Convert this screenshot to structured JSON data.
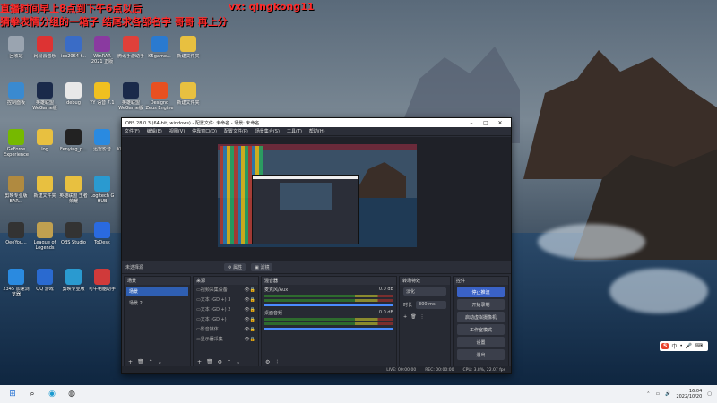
{
  "overlay": {
    "line1": "直播时间早上8点到下午6点以后",
    "line2": "猜拳表情分组的一箱子 结尾求各部名字 哥哥 再上分",
    "wx": "vx: qingkong11"
  },
  "desktop_icons": [
    {
      "label": "回收站",
      "color": "#9aa4b0"
    },
    {
      "label": "网易云音乐",
      "color": "#d33"
    },
    {
      "label": "ico2064-f...",
      "color": "#3a6cc6"
    },
    {
      "label": "WinRAR 2021 正版",
      "color": "#8a3aa0"
    },
    {
      "label": "腾讯手游助手",
      "color": "#e0403a"
    },
    {
      "label": "K5game...",
      "color": "#2a7ad0"
    },
    {
      "label": "新建文件夹",
      "color": "#e8c040"
    },
    {
      "label": "控制面板",
      "color": "#3a8ad0"
    },
    {
      "label": "英雄联盟 WeGame版",
      "color": "#1a2a4a"
    },
    {
      "label": "debug",
      "color": "#e8e8e8"
    },
    {
      "label": "YY 语音 7.1",
      "color": "#f0c020"
    },
    {
      "label": "英雄联盟 WeGame版",
      "color": "#1a2a4a"
    },
    {
      "label": "Designd Zeus Engine",
      "color": "#e85020"
    },
    {
      "label": "新建文件夹",
      "color": "#e8c040"
    },
    {
      "label": "GeForce Experience",
      "color": "#76b900"
    },
    {
      "label": "log",
      "color": "#e8c040"
    },
    {
      "label": "Fenying_p...",
      "color": "#222"
    },
    {
      "label": "迅雷影音",
      "color": "#2a8ae0"
    },
    {
      "label": "KLY-LOL 助手",
      "color": "#2a6ad0"
    },
    {
      "label": "Narakа",
      "color": "#e8c040"
    },
    {
      "label": "Idiot 4.0",
      "color": "#f0c020"
    },
    {
      "label": "剪映专业版 BAR...",
      "color": "#b08a40"
    },
    {
      "label": "新建文件夹",
      "color": "#e8c040"
    },
    {
      "label": "英雄联盟 王者荣耀",
      "color": "#e8c040"
    },
    {
      "label": "Logitech G HUB",
      "color": "#2a9ad0"
    },
    {
      "label": "剪映",
      "color": "#222"
    },
    {
      "label": "QQ 游戏",
      "color": "#2a6ad0"
    },
    {
      "label": "Microsoft Edge",
      "color": "#1a9ad0"
    },
    {
      "label": "QeeYou...",
      "color": "#333"
    },
    {
      "label": "League of Legends",
      "color": "#c0a050"
    },
    {
      "label": "OBS Studio",
      "color": "#333"
    },
    {
      "label": "ToDesk",
      "color": "#2a6ae0"
    },
    {
      "label": "QQ 游戏",
      "color": "#2a6ad0"
    },
    {
      "label": "雷电模拟器",
      "color": "#f0c020"
    },
    {
      "label": "腾讯QQ",
      "color": "#2a8ae0"
    },
    {
      "label": "2345 加速浏览器",
      "color": "#2a8ae0"
    },
    {
      "label": "QQ 游戏",
      "color": "#2a6ad0"
    },
    {
      "label": "剪映专业版",
      "color": "#2a9ad0"
    },
    {
      "label": "可牛电脑助手",
      "color": "#d03a3a"
    },
    {
      "label": "Adobe Premie...",
      "color": "#2a1a4a"
    },
    {
      "label": "RiotClient 快捷方式",
      "color": "#d03a3a"
    },
    {
      "label": "英雄联盟",
      "color": "#1a2a4a"
    }
  ],
  "obs": {
    "title": "OBS 28.0.3 (64-bit, windows) - 配置文件: 未命名 - 场景: 未命名",
    "menu": [
      "文件(F)",
      "编辑(E)",
      "视图(V)",
      "停靠窗口(D)",
      "配置文件(P)",
      "场景集合(S)",
      "工具(T)",
      "帮助(H)"
    ],
    "no_source": "未选择源",
    "properties": "属性",
    "filters": "滤镜",
    "docks": {
      "scenes": {
        "title": "场景",
        "items": [
          "场景",
          "场景 2"
        ]
      },
      "sources": {
        "title": "来源",
        "items": [
          "视频采集设备",
          "文本 (GDI+) 3",
          "文本 (GDI+) 2",
          "文本 (GDI+)",
          "影音媒体",
          "显示器采集"
        ]
      },
      "mixer": {
        "title": "混音器",
        "channels": [
          {
            "name": "麦克风/Aux",
            "db": "0.0 dB"
          },
          {
            "name": "桌面音频",
            "db": "0.0 dB"
          }
        ]
      },
      "transitions": {
        "title": "转场特效",
        "type": "淡化",
        "duration_label": "时长",
        "duration": "300 ms"
      },
      "controls": {
        "title": "控件",
        "buttons": [
          "停止推流",
          "开始录制",
          "启动虚拟摄像机",
          "工作室模式",
          "设置",
          "退出"
        ]
      }
    },
    "status": {
      "live": "LIVE: 00:00:00",
      "rec": "REC: 00:00:00",
      "cpu": "CPU: 3.8%, 22.07 fps"
    }
  },
  "taskbar": {
    "time": "16:04",
    "date": "2022/10/20"
  }
}
